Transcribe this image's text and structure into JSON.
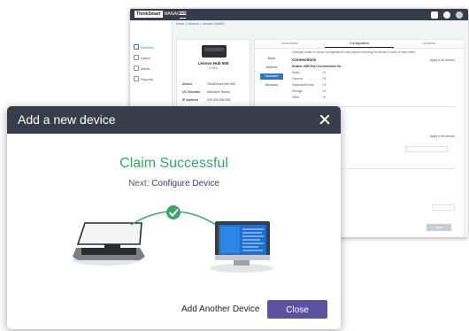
{
  "background_app": {
    "logo_brand": "ThinkSmart",
    "logo_suffix": "MANAGER",
    "sidebar": [
      {
        "label": "Devices",
        "active": true
      },
      {
        "label": "Users",
        "active": false
      },
      {
        "label": "Alerts",
        "active": false
      },
      {
        "label": "Reports",
        "active": false
      }
    ],
    "breadcrumb": "Home  >  Devices  >  Lenovo Hub500",
    "device_card": {
      "name": "Lenovo Hub 500",
      "status": "Online",
      "rows": [
        {
          "key": "Device",
          "value": "ThinkSmart Hub 500"
        },
        {
          "key": "UC Solution",
          "value": "Microsoft Teams"
        },
        {
          "key": "IP Address",
          "value": "203.255.255.255"
        }
      ]
    },
    "tabs": [
      {
        "label": "Information",
        "active": false
      },
      {
        "label": "Configuration",
        "active": true
      },
      {
        "label": "Updates",
        "active": false
      }
    ],
    "categories": [
      {
        "label": "Basic",
        "active": false
      },
      {
        "label": "Network",
        "active": false
      },
      {
        "label": "Hardware",
        "active": true
      },
      {
        "label": "Windows",
        "active": false
      }
    ],
    "config_description": "Changes made to certain configurations may require restarting the device in order to take effect.",
    "section_title": "Connections",
    "apply_all_label": "Apply to all devices",
    "subsection_title": "Enable USB Port Connections for",
    "connection_rows": [
      {
        "label": "Audio",
        "value": "Off"
      },
      {
        "label": "Camera",
        "value": "Off"
      },
      {
        "label": "Keyboard/Mouse",
        "value": "Off"
      },
      {
        "label": "Storage",
        "value": "Off"
      },
      {
        "label": "Other",
        "value": "Off"
      }
    ],
    "save_label": "Save"
  },
  "modal": {
    "title": "Add a new device",
    "claim_title": "Claim Successful",
    "next_label": "Next:",
    "next_link": "Configure Device",
    "add_another_label": "Add Another Device",
    "close_label": "Close"
  },
  "colors": {
    "header_bg": "#383e49",
    "success_green": "#3aa56a",
    "primary_purple": "#5c52a2",
    "link_navy": "#2c3f8a",
    "accent_blue": "#2b78c6"
  }
}
